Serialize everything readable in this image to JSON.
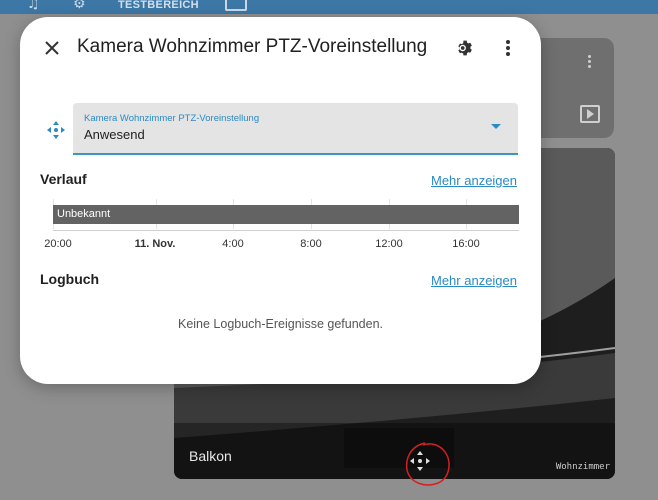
{
  "topbar": {
    "section_label": "TESTBEREICH",
    "icons": [
      "music-icon",
      "thermometer-icon",
      "monitor-icon"
    ],
    "color": "#3c77a6"
  },
  "background_cards": {
    "camera_label": "Balkon",
    "camera_watermark": "Wohnzimmer"
  },
  "dialog": {
    "title": "Kamera Wohnzimmer PTZ-Voreinstellung",
    "select": {
      "label": "Kamera Wohnzimmer PTZ-Voreinstellung",
      "value": "Anwesend"
    },
    "history": {
      "title": "Verlauf",
      "more_link": "Mehr anzeigen",
      "bar_state": "Unbekannt",
      "time_labels": [
        "20:00",
        "11. Nov.",
        "4:00",
        "8:00",
        "12:00",
        "16:00"
      ]
    },
    "logbook": {
      "title": "Logbuch",
      "more_link": "Mehr anzeigen",
      "empty_message": "Keine Logbuch-Ereignisse gefunden."
    }
  },
  "colors": {
    "accent": "#2b8bc3",
    "bar": "#636363",
    "annotation": "#d42020"
  }
}
